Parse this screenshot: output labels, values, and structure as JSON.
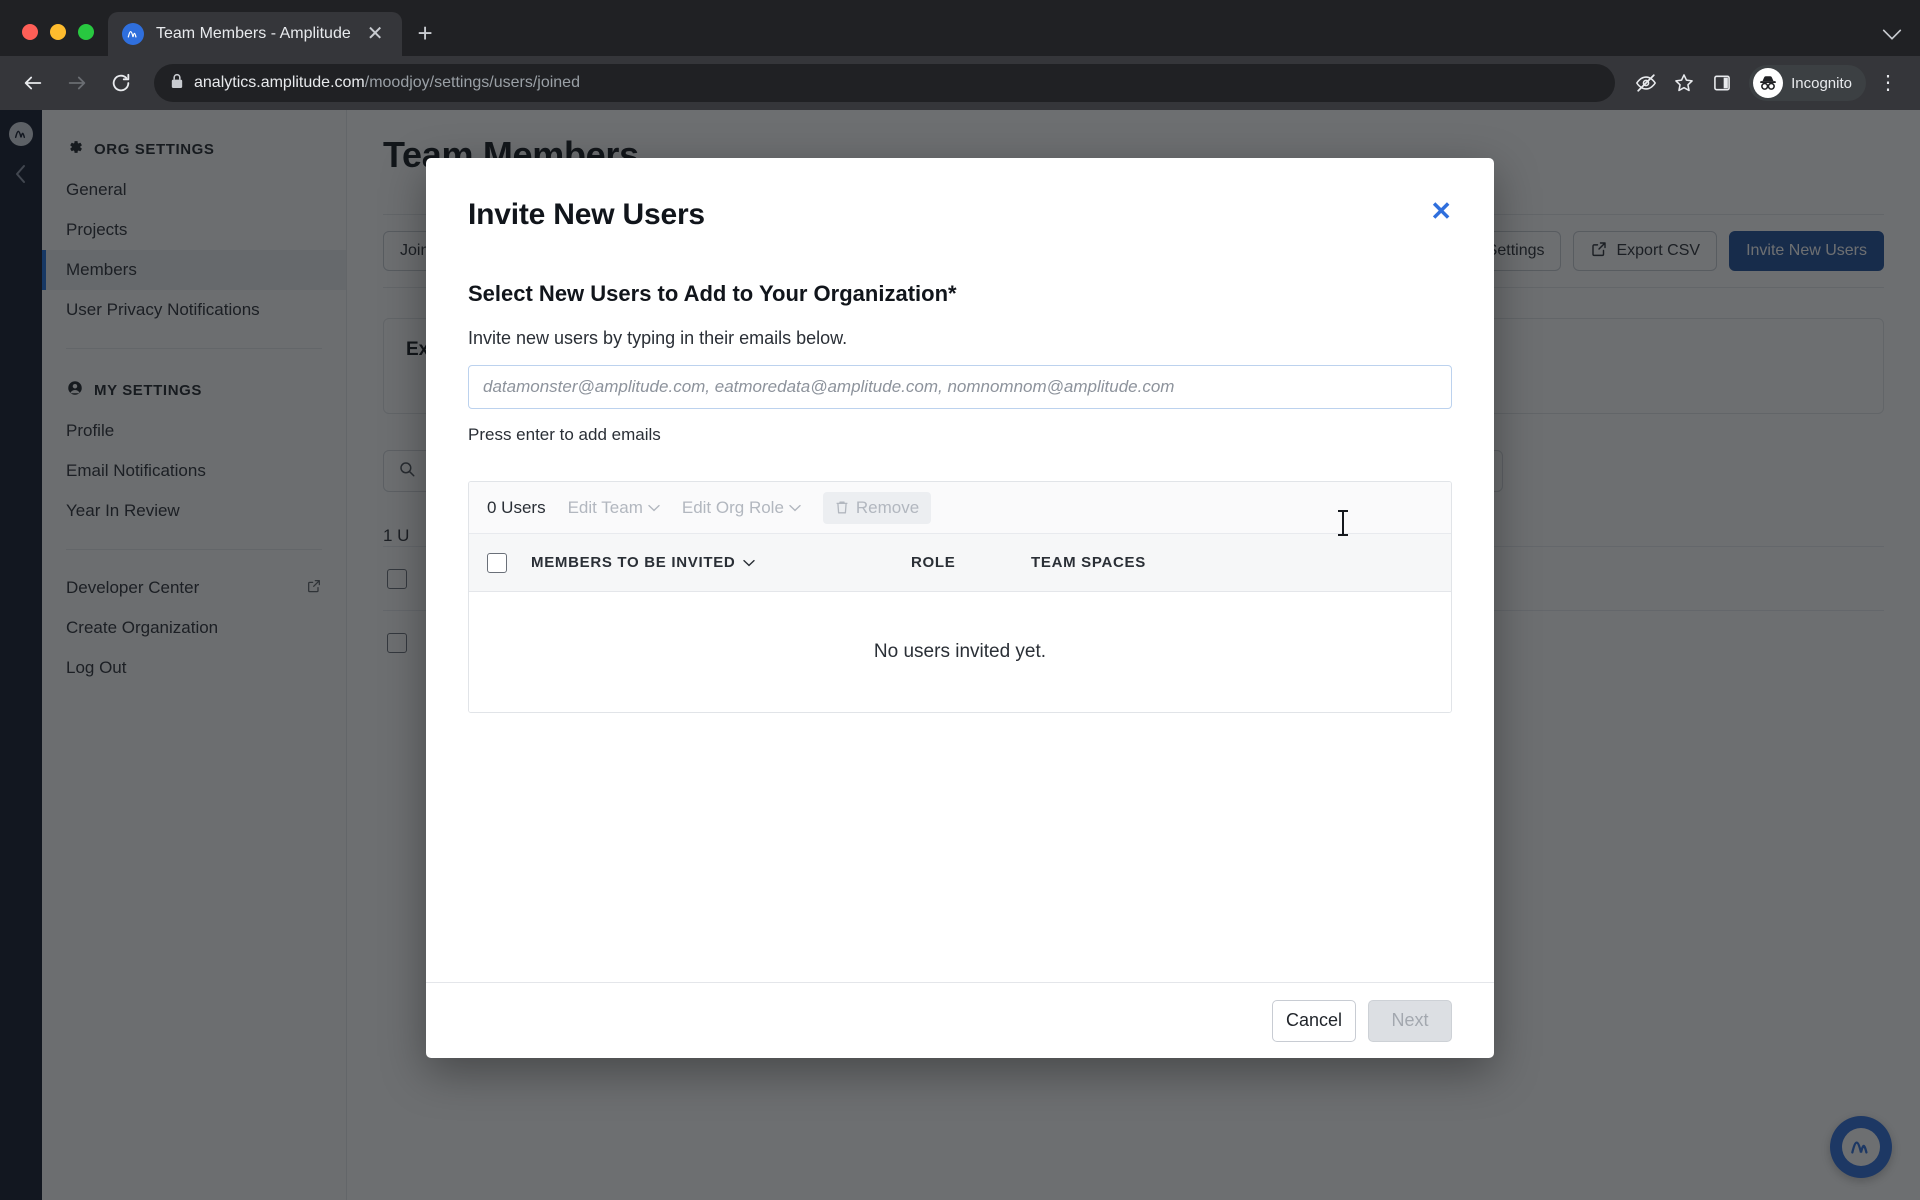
{
  "browser": {
    "tab": {
      "title": "Team Members - Amplitude",
      "favicon_icon": "amplitude-logo-icon",
      "close_icon": "close-icon"
    },
    "new_tab_icon": "plus-icon",
    "tabstrip_chevron_icon": "chevron-down-icon",
    "back_icon": "arrow-left-icon",
    "forward_icon": "arrow-right-icon",
    "reload_icon": "reload-icon",
    "omnibox": {
      "lock_icon": "lock-icon",
      "host": "analytics.amplitude.com",
      "path": "/moodjoy/settings/users/joined"
    },
    "toolbar_icons": [
      "eye-off-icon",
      "star-icon",
      "side-panel-icon"
    ],
    "profile": {
      "label": "Incognito",
      "icon": "incognito-icon"
    },
    "menu_icon": "kebab-menu-icon"
  },
  "rail": {
    "logo_icon": "amplitude-logo-icon",
    "collapse_icon": "chevron-left-icon"
  },
  "sidebar": {
    "sections": [
      {
        "title": "ORG SETTINGS",
        "icon": "gear-icon",
        "items": [
          {
            "label": "General",
            "active": false
          },
          {
            "label": "Projects",
            "active": false
          },
          {
            "label": "Members",
            "active": true
          },
          {
            "label": "User Privacy Notifications",
            "active": false
          }
        ]
      },
      {
        "title": "MY SETTINGS",
        "icon": "user-circle-icon",
        "items": [
          {
            "label": "Profile",
            "active": false
          },
          {
            "label": "Email Notifications",
            "active": false
          },
          {
            "label": "Year In Review",
            "active": false
          }
        ]
      }
    ],
    "links": [
      {
        "label": "Developer Center",
        "external": true,
        "external_icon": "external-link-icon"
      },
      {
        "label": "Create Organization",
        "external": false
      },
      {
        "label": "Log Out",
        "external": false
      }
    ]
  },
  "main": {
    "page_title": "Team Members",
    "toolbar": {
      "joined_label": "Joined",
      "settings_label": "Settings",
      "export_label": "Export CSV",
      "export_icon": "export-icon",
      "invite_label": "Invite New Users"
    },
    "card": {
      "title": "Existing Access"
    },
    "search": {
      "placeholder": "",
      "icon": "search-icon"
    },
    "count_label": "1 U",
    "fab_icon": "amplitude-logo-icon"
  },
  "modal": {
    "title": "Invite New Users",
    "close_icon": "close-icon",
    "subtitle": "Select New Users to Add to Your Organization*",
    "help": "Invite new users by typing in their emails below.",
    "email_input": {
      "value": "",
      "placeholder": "datamonster@amplitude.com, eatmoredata@amplitude.com, nomnomnom@amplitude.com"
    },
    "hint": "Press enter to add emails",
    "table": {
      "toolbar": {
        "count_label": "0 Users",
        "edit_team_label": "Edit Team",
        "edit_team_icon": "chevron-down-icon",
        "edit_role_label": "Edit Org Role",
        "edit_role_icon": "chevron-down-icon",
        "remove_label": "Remove",
        "remove_icon": "trash-icon"
      },
      "columns": [
        {
          "label": "MEMBERS TO BE INVITED",
          "sort_icon": "chevron-down-icon"
        },
        {
          "label": "ROLE",
          "sort_icon": ""
        },
        {
          "label": "TEAM SPACES",
          "sort_icon": ""
        }
      ],
      "empty_message": "No users invited yet."
    },
    "footer": {
      "cancel_label": "Cancel",
      "next_label": "Next"
    }
  },
  "colors": {
    "accent_blue": "#2f6fdd",
    "primary_button": "#1f4f9c",
    "active_item_bar": "#1f6fde",
    "rail_background": "#11192b"
  }
}
